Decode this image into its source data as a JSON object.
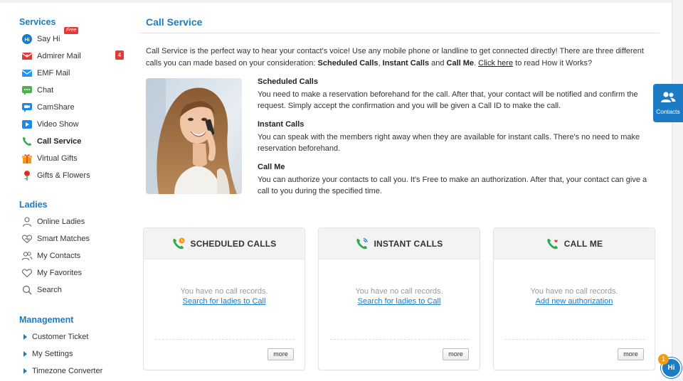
{
  "sidebar": {
    "services_title": "Services",
    "services": [
      {
        "label": "Say Hi",
        "icon": "say-hi-icon",
        "badge": "Free"
      },
      {
        "label": "Admirer Mail",
        "icon": "admirer-mail-icon",
        "badge": "4"
      },
      {
        "label": "EMF Mail",
        "icon": "mail-icon"
      },
      {
        "label": "Chat",
        "icon": "chat-icon"
      },
      {
        "label": "CamShare",
        "icon": "camshare-icon"
      },
      {
        "label": "Video Show",
        "icon": "video-icon"
      },
      {
        "label": "Call Service",
        "icon": "phone-icon",
        "active": true
      },
      {
        "label": "Virtual Gifts",
        "icon": "gift-icon"
      },
      {
        "label": "Gifts & Flowers",
        "icon": "flower-icon"
      }
    ],
    "ladies_title": "Ladies",
    "ladies": [
      {
        "label": "Online Ladies",
        "icon": "user-icon"
      },
      {
        "label": "Smart Matches",
        "icon": "heart-outline-icon"
      },
      {
        "label": "My Contacts",
        "icon": "contacts-icon"
      },
      {
        "label": "My Favorites",
        "icon": "heart-icon"
      },
      {
        "label": "Search",
        "icon": "search-icon"
      }
    ],
    "management_title": "Management",
    "management": [
      {
        "label": "Customer Ticket"
      },
      {
        "label": "My Settings"
      },
      {
        "label": "Timezone Converter"
      }
    ]
  },
  "main": {
    "title": "Call Service",
    "intro_1": "Call Service is the perfect way to hear your contact's voice! Use any mobile phone or landline to get connected directly! There are three different calls you can made based on your consideration: ",
    "intro_b1": "Scheduled Calls",
    "intro_sep1": ", ",
    "intro_b2": "Instant Calls",
    "intro_sep2": " and ",
    "intro_b3": "Call Me",
    "intro_sep3": ". ",
    "intro_link": "Click here",
    "intro_end": " to read How it Works?",
    "descriptions": [
      {
        "title": "Scheduled Calls",
        "text": "You need to make a reservation beforehand for the call. After that, your contact will be notified and confirm the request. Simply accept the confirmation and you will be given a Call ID to make the call."
      },
      {
        "title": "Instant Calls",
        "text": "You can speak with the members right away when they are available for instant calls. There's no need to make reservation beforehand."
      },
      {
        "title": "Call Me",
        "text": "You can authorize your contacts to call you. It's Free to make an authorization. After that, your contact can give a call to you during the specified time."
      }
    ],
    "cards": [
      {
        "title": "SCHEDULED CALLS",
        "empty": "You have no call records.",
        "link": "Search for ladies to Call",
        "more": "more",
        "icon": "scheduled-call-icon"
      },
      {
        "title": "INSTANT CALLS",
        "empty": "You have no call records.",
        "link": "Search for ladies to Call",
        "more": "more",
        "icon": "instant-call-icon"
      },
      {
        "title": "CALL ME",
        "empty": "You have no call records.",
        "link": "Add new authorization",
        "more": "more",
        "icon": "call-me-icon"
      }
    ]
  },
  "floating": {
    "contacts_label": "Contacts",
    "hi_label": "Hi",
    "hi_count": "1"
  },
  "colors": {
    "accent": "#1b7cc4",
    "badge": "#e53935",
    "phone_green": "#2eaa4f",
    "notify_orange": "#f39c12"
  }
}
